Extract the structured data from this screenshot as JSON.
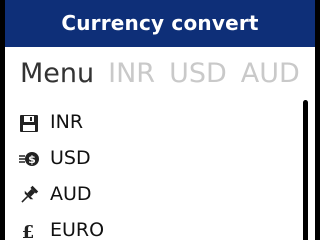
{
  "header": {
    "title": "Currency convert"
  },
  "pivot": {
    "tabs": [
      {
        "label": "Menu",
        "active": true
      },
      {
        "label": "INR",
        "active": false
      },
      {
        "label": "USD",
        "active": false
      },
      {
        "label": "AUD",
        "active": false
      }
    ]
  },
  "menu": {
    "items": [
      {
        "label": "INR",
        "icon": "floppy-disk-icon"
      },
      {
        "label": "USD",
        "icon": "coin-dollar-icon"
      },
      {
        "label": "AUD",
        "icon": "pin-icon"
      },
      {
        "label": "EURO",
        "icon": "pound-sign-icon"
      }
    ]
  },
  "colors": {
    "header_bg": "#0e2f78",
    "header_text": "#ffffff",
    "active_tab": "#333333",
    "inactive_tab": "#c9c9c9"
  }
}
